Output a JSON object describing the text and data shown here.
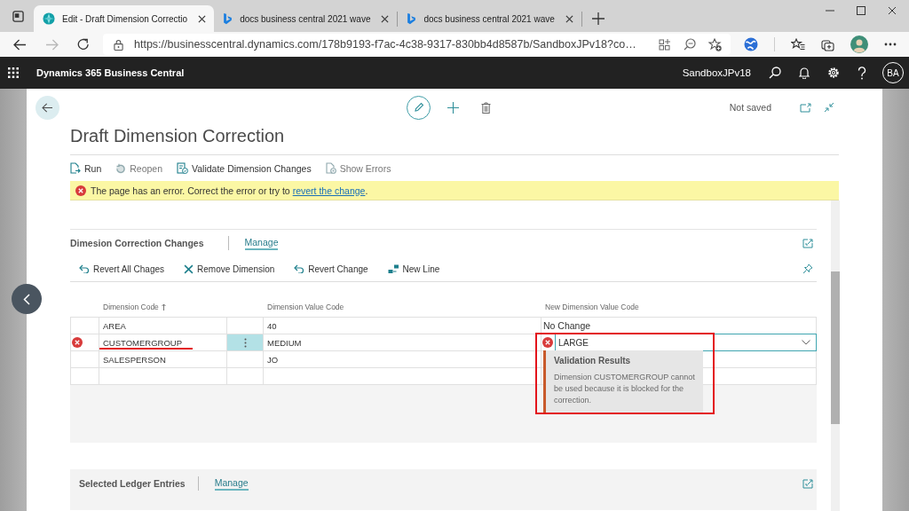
{
  "browser": {
    "tabs": [
      {
        "kind": "app",
        "title": "Edit - Draft Dimension Correctio",
        "selected": true
      },
      {
        "kind": "web",
        "title": "docs business central 2021 wave",
        "selected": false
      },
      {
        "kind": "web",
        "title": "docs business central 2021 wave",
        "selected": false
      }
    ],
    "nav_buttons": [
      {
        "kind": "back",
        "disabled": false
      },
      {
        "kind": "forward",
        "disabled": true
      },
      {
        "kind": "refresh",
        "disabled": false
      }
    ],
    "url": "https://businesscentral.dynamics.com/178b9193-f7ac-4c38-9317-830bb4d8587b/SandboxJPv18?co…"
  },
  "app_bar": {
    "product": "Dynamics 365 Business Central",
    "environment": "SandboxJPv18",
    "user_initials": "BA"
  },
  "page": {
    "status": "Not saved",
    "title": "Draft Dimension Correction",
    "actions": [
      {
        "kind": "run",
        "label": "Run",
        "disabled": false
      },
      {
        "kind": "reopen",
        "label": "Reopen",
        "disabled": true
      },
      {
        "kind": "validate",
        "label": "Validate Dimension Changes",
        "disabled": false
      },
      {
        "kind": "errors",
        "label": "Show Errors",
        "disabled": true
      }
    ],
    "error_banner": {
      "text": "The page has an error. Correct the error or try to",
      "link": "revert the change",
      "end": "."
    }
  },
  "changes": {
    "title": "Dimesion Correction Changes",
    "manage": "Manage",
    "actions": [
      {
        "kind": "revert",
        "label": "Revert All Chages"
      },
      {
        "kind": "remove",
        "label": "Remove Dimension"
      },
      {
        "kind": "revert",
        "label": "Revert Change"
      },
      {
        "kind": "new-line",
        "label": "New Line"
      }
    ],
    "columns": [
      {
        "label": "Dimension Code",
        "sorted": true
      },
      {
        "label": "Dimension Value Code",
        "sorted": false
      },
      {
        "label": "New Dimension Value Code",
        "sorted": false
      }
    ],
    "rows": [
      {
        "kind": "entry",
        "code": "AREA",
        "value": "40",
        "new_value": "No Change",
        "error": false,
        "selected": false,
        "editing": false,
        "underlined": false
      },
      {
        "kind": "entry",
        "code": "CUSTOMERGROUP",
        "value": "MEDIUM",
        "new_value": "LARGE",
        "error": true,
        "selected": true,
        "editing": true,
        "underlined": true,
        "validation": {
          "title": "Validation Results",
          "message": "Dimension CUSTOMERGROUP cannot be used because it is blocked for the correction.",
          "framed": true
        }
      },
      {
        "kind": "entry",
        "code": "SALESPERSON",
        "value": "JO",
        "error": false,
        "selected": false,
        "editing": false,
        "underlined": false
      },
      {
        "kind": "blank",
        "selected": false
      }
    ]
  },
  "ledger_entries": {
    "title": "Selected Ledger Entries",
    "manage": "Manage"
  }
}
